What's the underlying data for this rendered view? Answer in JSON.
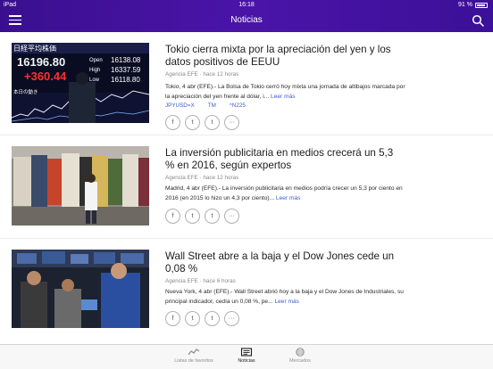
{
  "status": {
    "device": "iPad",
    "time": "16:18",
    "battery": "91 %"
  },
  "nav": {
    "title": "Noticias"
  },
  "articles": [
    {
      "headline": "Tokio cierra mixta por la apreciación del yen y los datos positivos de EEUU",
      "meta": "Agencia EFE · hace 12 horas",
      "summary": "Tokio, 4 abr (EFE).- La Bolsa de Tokio cerró hoy mixta una jornada de altibajos marcada por la apreciación del yen frente al dólar, i...",
      "more": "Leer más",
      "tickers": [
        "JPYUSD=X",
        "TM",
        "^N225"
      ],
      "board": {
        "title": "日経平均株価",
        "value": "16196.80",
        "change": "+360.44",
        "open_label": "Open",
        "open": "16138.08",
        "high_label": "High",
        "high": "16337.59",
        "low_label": "Low",
        "low": "16118.80",
        "footer": "本日の動き"
      }
    },
    {
      "headline": "La inversión publicitaria en medios crecerá un 5,3 % en 2016, según expertos",
      "meta": "Agencia EFE · hace 12 horas",
      "summary": "Madrid, 4 abr (EFE).- La inversión publicitaria en medios podría crecer un 5,3 por ciento en 2016 (en 2015 lo hizo un 4,3 por ciento)...",
      "more": "Leer más"
    },
    {
      "headline": "Wall Street abre a la baja y el Dow Jones cede un 0,08 %",
      "meta": "Agencia EFE · hace 6 horas",
      "summary": "Nueva York, 4 abr (EFE).- Wall Street abrió hoy a la baja y el Dow Jones de Industriales, su principal indicador, cedía un 0,08 %, pe...",
      "more": "Leer más"
    }
  ],
  "share_icons": [
    "facebook-icon",
    "twitter-icon",
    "tumblr-icon",
    "more-icon"
  ],
  "share_glyphs": [
    "f",
    "t",
    "t",
    "···"
  ],
  "tabs": [
    {
      "label": "Listas de favoritos",
      "icon": "chart-line-icon"
    },
    {
      "label": "Noticias",
      "icon": "news-icon",
      "active": true
    },
    {
      "label": "Mercados",
      "icon": "globe-icon"
    }
  ],
  "colors": {
    "nav": "#4a14a8",
    "link": "#3a5bd0",
    "board_change": "#ff3030"
  }
}
